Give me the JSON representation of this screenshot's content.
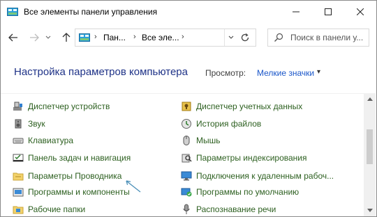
{
  "window": {
    "title": "Все элементы панели управления",
    "minimize_icon": "minimize-icon",
    "maximize_icon": "maximize-icon",
    "close_icon": "close-icon"
  },
  "nav": {
    "back_icon": "back-arrow-icon",
    "forward_icon": "forward-arrow-icon",
    "recent_icon": "chevron-down-icon",
    "up_icon": "up-arrow-icon",
    "breadcrumb": [
      "Пан...",
      "Все эле..."
    ],
    "refresh_icon": "refresh-icon",
    "search_placeholder": "Поиск в панели у..."
  },
  "header": {
    "title": "Настройка параметров компьютера",
    "view_label": "Просмотр:",
    "view_value": "Мелкие значки",
    "view_dropdown_glyph": "▾"
  },
  "items_left": [
    {
      "label": "Диспетчер устройств",
      "icon": "device-manager-icon"
    },
    {
      "label": "Звук",
      "icon": "speaker-icon"
    },
    {
      "label": "Клавиатура",
      "icon": "keyboard-icon"
    },
    {
      "label": "Панель задач и навигация",
      "icon": "taskbar-icon"
    },
    {
      "label": "Параметры Проводника",
      "icon": "folder-options-icon"
    },
    {
      "label": "Программы и компоненты",
      "icon": "programs-icon"
    },
    {
      "label": "Рабочие папки",
      "icon": "work-folders-icon"
    }
  ],
  "items_right": [
    {
      "label": "Диспетчер учетных данных",
      "icon": "credential-manager-icon"
    },
    {
      "label": "История файлов",
      "icon": "file-history-icon"
    },
    {
      "label": "Мышь",
      "icon": "mouse-icon"
    },
    {
      "label": "Параметры индексирования",
      "icon": "indexing-icon"
    },
    {
      "label": "Подключения к удаленным рабоч...",
      "icon": "remote-desktop-icon"
    },
    {
      "label": "Программы по умолчанию",
      "icon": "default-programs-icon"
    },
    {
      "label": "Распознавание речи",
      "icon": "microphone-icon"
    }
  ],
  "colors": {
    "link_green": "#2c5f1f",
    "heading_blue": "#1e3287",
    "accent_blue": "#1a56c9"
  }
}
